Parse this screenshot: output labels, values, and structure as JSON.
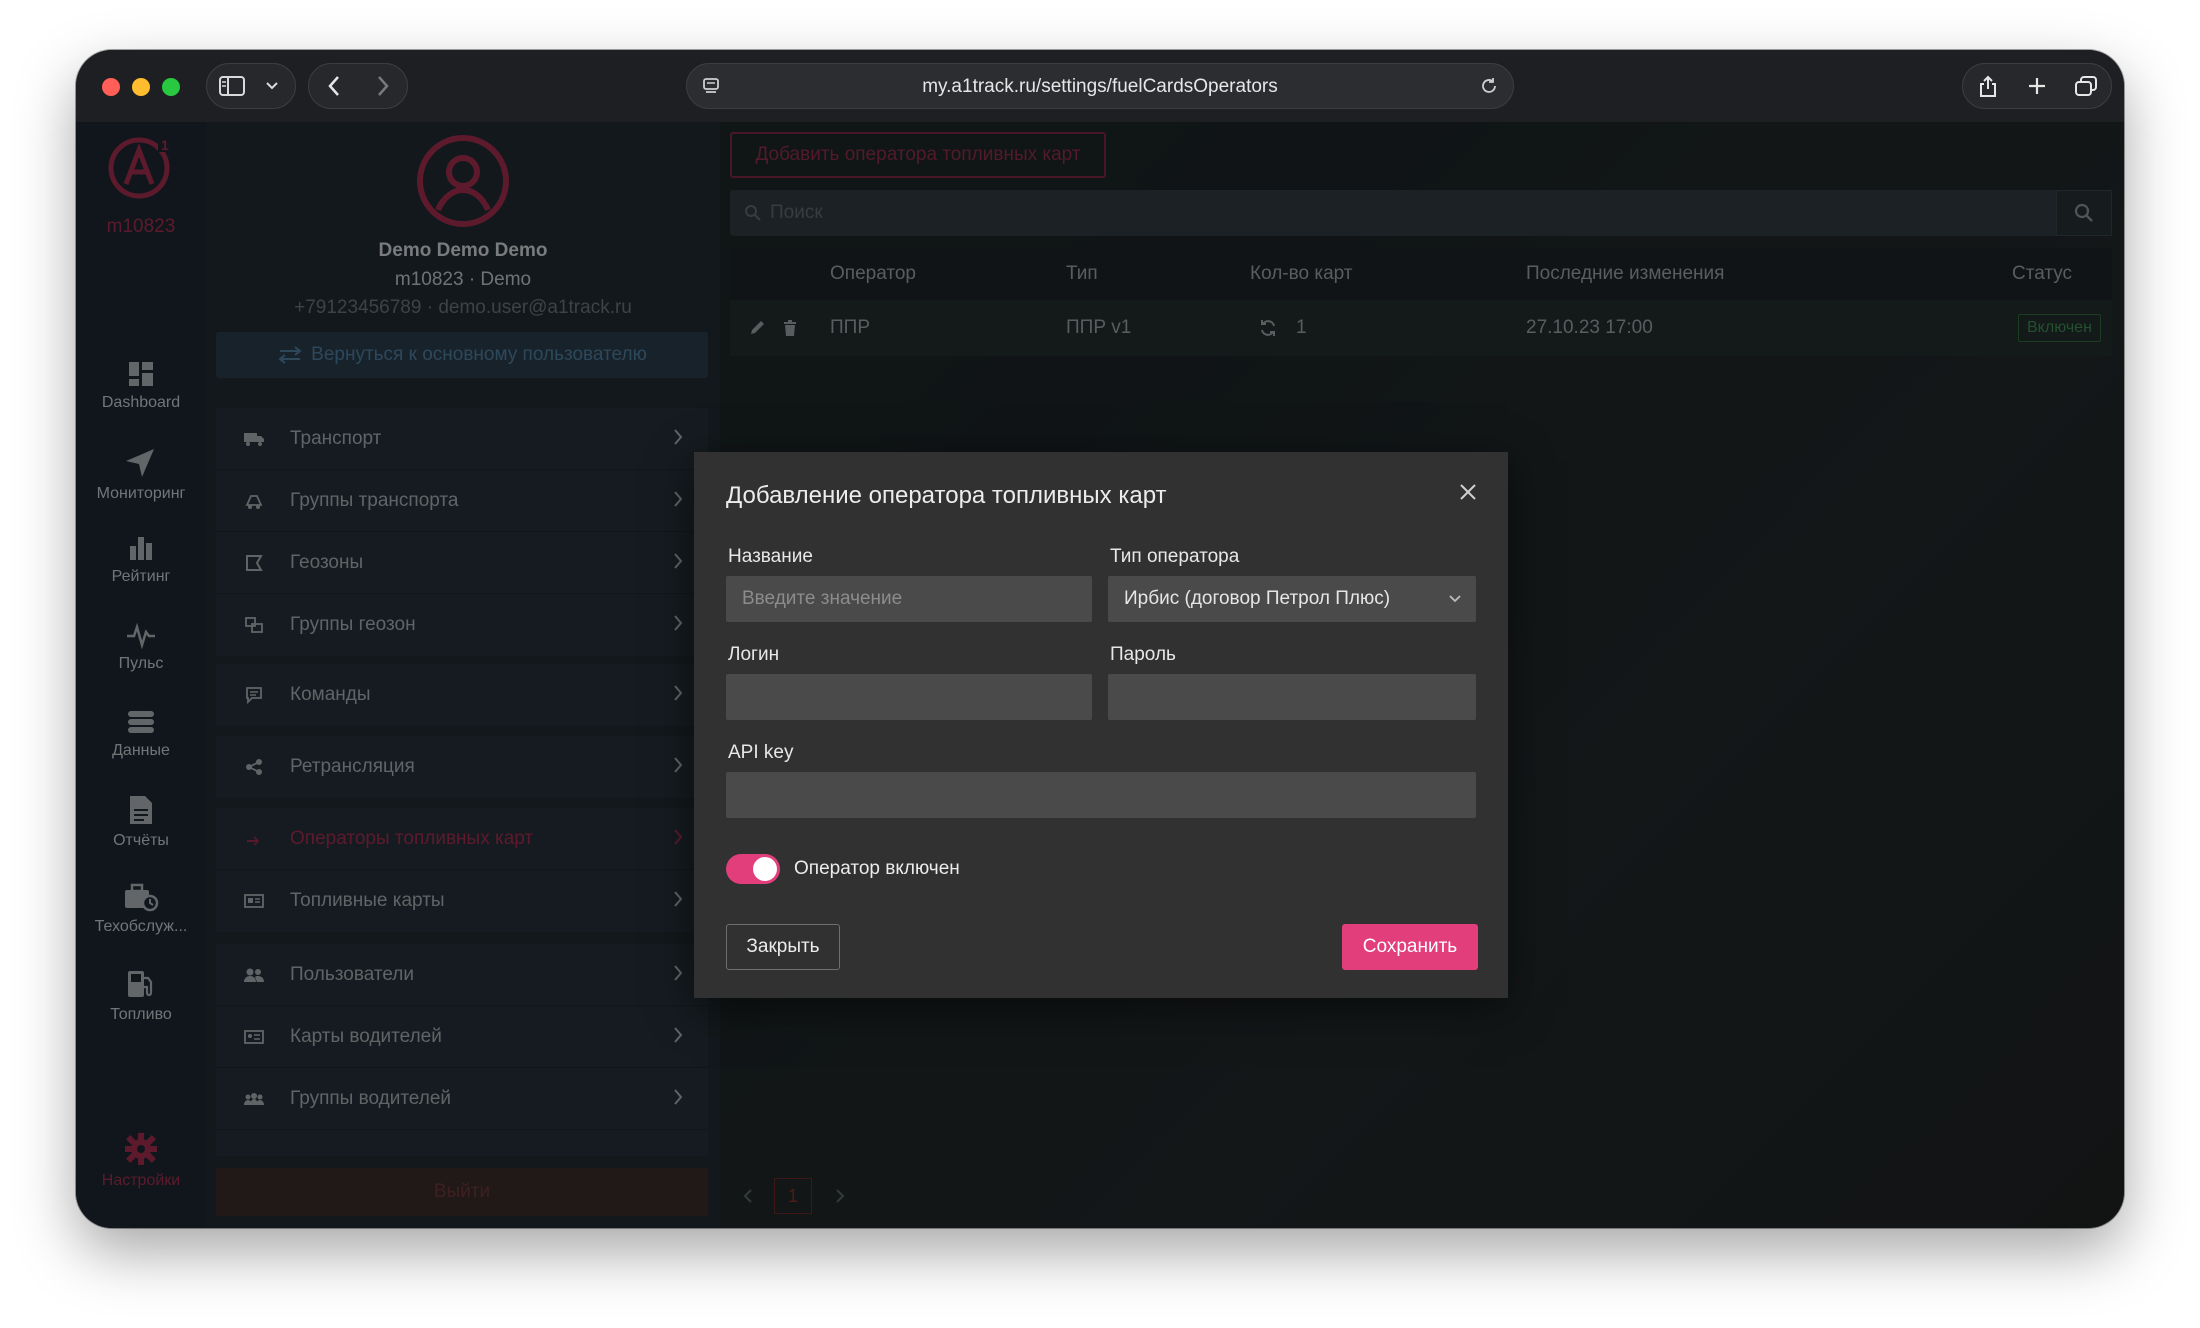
{
  "browser": {
    "url": "my.a1track.ru/settings/fuelCardsOperators"
  },
  "rail": {
    "account_code": "m10823",
    "items": [
      {
        "label": "Dashboard",
        "icon": "dashboard-icon"
      },
      {
        "label": "Мониторинг",
        "icon": "monitoring-icon"
      },
      {
        "label": "Рейтинг",
        "icon": "rating-icon"
      },
      {
        "label": "Пульс",
        "icon": "pulse-icon"
      },
      {
        "label": "Данные",
        "icon": "data-icon"
      },
      {
        "label": "Отчёты",
        "icon": "reports-icon"
      },
      {
        "label": "Техобслуж...",
        "icon": "maintenance-icon"
      },
      {
        "label": "Топливо",
        "icon": "fuel-icon"
      },
      {
        "label": "Настройки",
        "icon": "settings-icon"
      }
    ]
  },
  "profile": {
    "name": "Demo Demo Demo",
    "subtitle": "m10823 · Demo",
    "contact": "+79123456789 · demo.user@a1track.ru",
    "back_button": "Вернуться к основному пользователю"
  },
  "menu": {
    "items": [
      {
        "label": "Транспорт",
        "icon": "truck-icon"
      },
      {
        "label": "Группы транспорта",
        "icon": "transport-groups-icon"
      },
      {
        "label": "Геозоны",
        "icon": "geozone-icon"
      },
      {
        "label": "Группы геозон",
        "icon": "geozone-groups-icon"
      },
      {
        "label": "Команды",
        "icon": "commands-icon"
      },
      {
        "label": "Ретрансляция",
        "icon": "share-icon"
      },
      {
        "label": "Операторы топливных карт",
        "icon": "fuel-operators-icon"
      },
      {
        "label": "Топливные карты",
        "icon": "fuel-card-icon"
      },
      {
        "label": "Пользователи",
        "icon": "users-icon"
      },
      {
        "label": "Карты водителей",
        "icon": "driver-card-icon"
      },
      {
        "label": "Группы водителей",
        "icon": "driver-groups-icon"
      }
    ],
    "logout": "Выйти"
  },
  "main": {
    "add_button": "Добавить оператора топливных карт",
    "search_placeholder": "Поиск",
    "table": {
      "headers": [
        "Оператор",
        "Тип",
        "Кол-во карт",
        "Последние изменения",
        "Статус"
      ],
      "rows": [
        {
          "operator": "ППР",
          "type": "ППР v1",
          "cards": "1",
          "changed": "27.10.23 17:00",
          "status": "Включен"
        }
      ]
    },
    "pager": {
      "current": "1"
    }
  },
  "modal": {
    "title": "Добавление оператора топливных карт",
    "name_label": "Название",
    "name_placeholder": "Введите значение",
    "type_label": "Тип оператора",
    "type_value": "Ирбис (договор Петрол Плюс)",
    "login_label": "Логин",
    "password_label": "Пароль",
    "api_label": "API key",
    "toggle_label": "Оператор включен",
    "toggle_on": true,
    "close_button": "Закрыть",
    "save_button": "Сохранить"
  },
  "colors": {
    "accent": "#e23e7b",
    "accent_dim": "#a12e4c",
    "status_green": "#3d8a4e"
  }
}
